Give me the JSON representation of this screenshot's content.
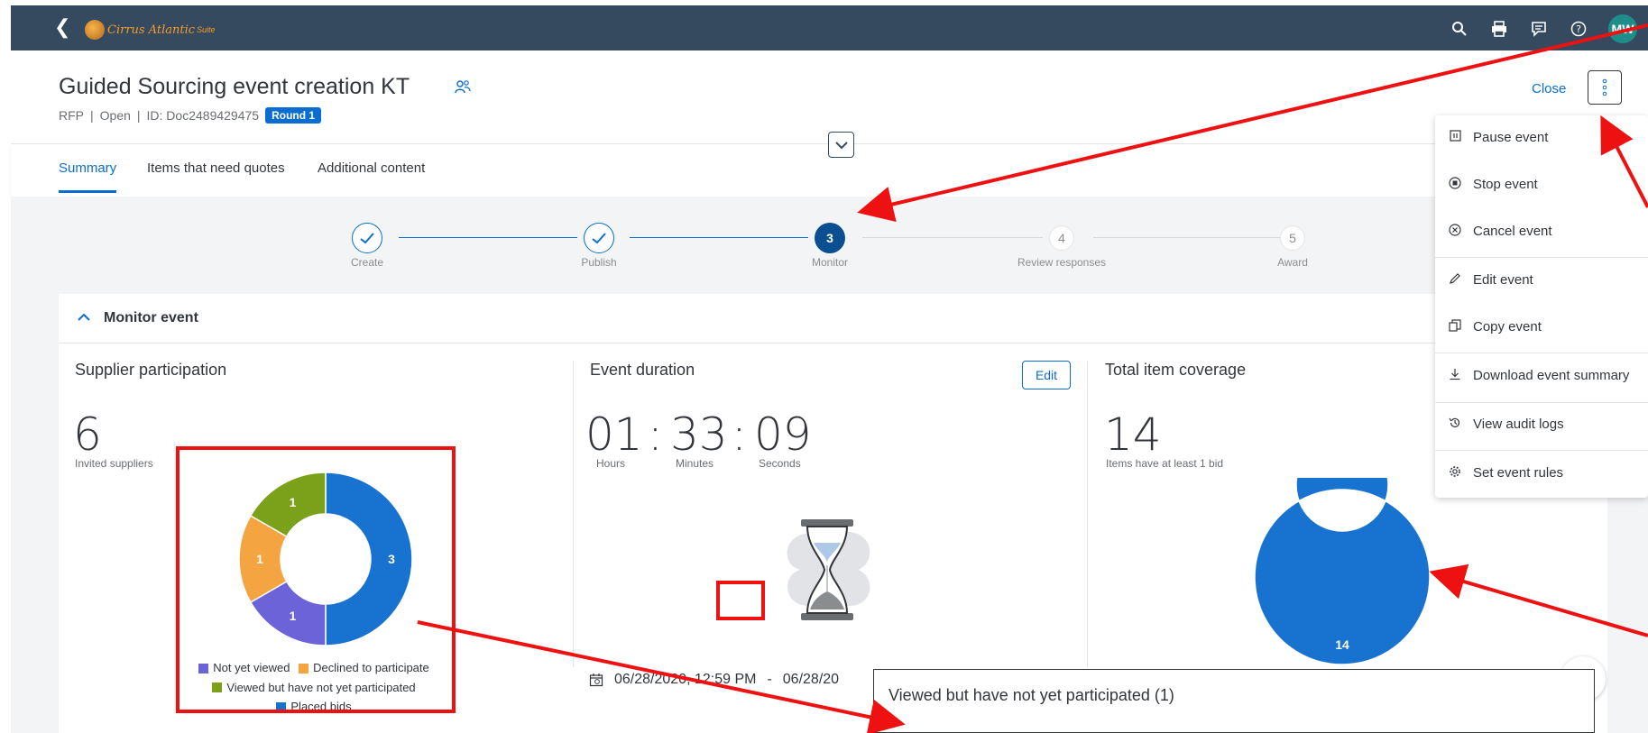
{
  "shell": {
    "logo_text": "Cirrus Atlantic",
    "logo_suite": "Suite",
    "avatar_initials": "MW",
    "icons": [
      "search-icon",
      "print-icon",
      "feedback-icon",
      "help-icon"
    ]
  },
  "header": {
    "title": "Guided Sourcing event creation KT",
    "type": "RFP",
    "sep": "|",
    "status": "Open",
    "id_label": "ID: Doc2489429475",
    "round_badge": "Round 1",
    "close_label": "Close"
  },
  "tabs": [
    {
      "label": "Summary",
      "active": true
    },
    {
      "label": "Items that need quotes",
      "active": false
    },
    {
      "label": "Additional content",
      "active": false
    }
  ],
  "stepper": [
    {
      "label": "Create",
      "state": "done",
      "num": ""
    },
    {
      "label": "Publish",
      "state": "done",
      "num": ""
    },
    {
      "label": "Monitor",
      "state": "current",
      "num": "3"
    },
    {
      "label": "Review responses",
      "state": "todo",
      "num": "4"
    },
    {
      "label": "Award",
      "state": "todo",
      "num": "5"
    }
  ],
  "monitor": {
    "title": "Monitor event",
    "supplier": {
      "title": "Supplier participation",
      "count": "6",
      "count_label": "Invited suppliers"
    },
    "duration": {
      "title": "Event duration",
      "edit_label": "Edit",
      "hours": "01",
      "minutes": "33",
      "seconds": "09",
      "colon": ":",
      "hours_label": "Hours",
      "minutes_label": "Minutes",
      "seconds_label": "Seconds",
      "start": "06/28/2020, 12:59 PM",
      "dash": "-",
      "end_partial": "06/28/20"
    },
    "coverage": {
      "title": "Total item coverage",
      "count": "14",
      "count_label": "Items have at least 1 bid"
    }
  },
  "menu": [
    {
      "label": "Pause event",
      "icon": "pause-icon"
    },
    {
      "label": "Stop event",
      "icon": "stop-icon"
    },
    {
      "label": "Cancel event",
      "icon": "cancel-icon"
    },
    {
      "label": "Edit event",
      "icon": "edit-icon"
    },
    {
      "label": "Copy event",
      "icon": "copy-icon"
    },
    {
      "label": "Download event summary",
      "icon": "download-icon"
    },
    {
      "label": "View audit logs",
      "icon": "history-icon"
    },
    {
      "label": "Set event rules",
      "icon": "gear-icon"
    }
  ],
  "popover": {
    "title": "Viewed but have not yet participated (1)"
  },
  "colors": {
    "shell": "#354a5f",
    "accent": "#0a6ed1",
    "placed": "#1872d0",
    "not_viewed": "#6c63d9",
    "declined": "#f5a442",
    "viewed_not_participated": "#7ba11a",
    "annotation": "#ee1111"
  },
  "chart_data": [
    {
      "type": "pie",
      "categories": [
        "Placed bids",
        "Not yet viewed",
        "Declined to participate",
        "Viewed but have not yet participated"
      ],
      "values": [
        3,
        1,
        1,
        1
      ]
    },
    {
      "type": "pie",
      "categories": [
        "Items have at least 1 bid"
      ],
      "values": [
        14
      ]
    }
  ]
}
